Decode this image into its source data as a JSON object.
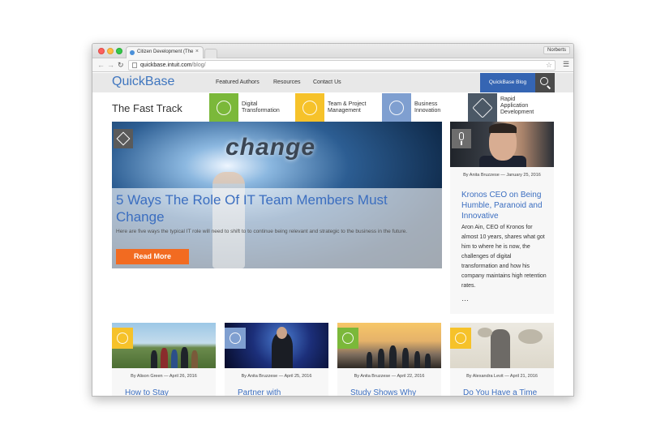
{
  "browser": {
    "tab_title": "Citizen Development (IT) ×",
    "tab_title_short": "Citizen Development (The",
    "profile_name": "Norberts",
    "url_host": "quickbase.intuit.com",
    "url_path": "/blog/"
  },
  "site": {
    "logo": "QuickBase",
    "nav": [
      "Featured Authors",
      "Resources",
      "Contact Us"
    ],
    "blog_button": "QuickBase Blog",
    "section_title": "The Fast Track",
    "categories": [
      {
        "label": "Digital\nTransformation",
        "color": "#7bb83a"
      },
      {
        "label": "Team & Project\nManagement",
        "color": "#f6c22a"
      },
      {
        "label": "Business\nInnovation",
        "color": "#7f9fd0"
      },
      {
        "label": "Rapid\nApplication\nDevelopment",
        "color": "#4b5866"
      }
    ]
  },
  "hero": {
    "image_word": "change",
    "title": "5 Ways The Role Of IT Team Members Must Change",
    "excerpt": "Here are five ways the typical IT role will need to shift to to continue being relevant and strategic to the business in the future.",
    "button": "Read More"
  },
  "sidebar_post": {
    "byline": "By Anita Bruzzese — January 25, 2016",
    "title": "Kronos CEO on Being Humble, Paranoid and Innovative",
    "excerpt": "Aron Ain, CEO of Kronos for almost 10 years, shares what got him to where he is now, the challenges of digital transformation and how his company maintains high retention rates.",
    "more": "…"
  },
  "cards": [
    {
      "byline": "By Alison Green — April 26, 2016",
      "title": "How to Stay",
      "badge_color": "#f6c22a"
    },
    {
      "byline": "By Anita Bruzzese — April 25, 2016",
      "title": "Partner with",
      "badge_color": "#7f9fd0"
    },
    {
      "byline": "By Anita Bruzzese — April 22, 2016",
      "title": "Study Shows Why",
      "badge_color": "#7bb83a"
    },
    {
      "byline": "By Alexandra Levit — April 21, 2016",
      "title": "Do You Have a Time",
      "badge_color": "#f6c22a"
    }
  ]
}
